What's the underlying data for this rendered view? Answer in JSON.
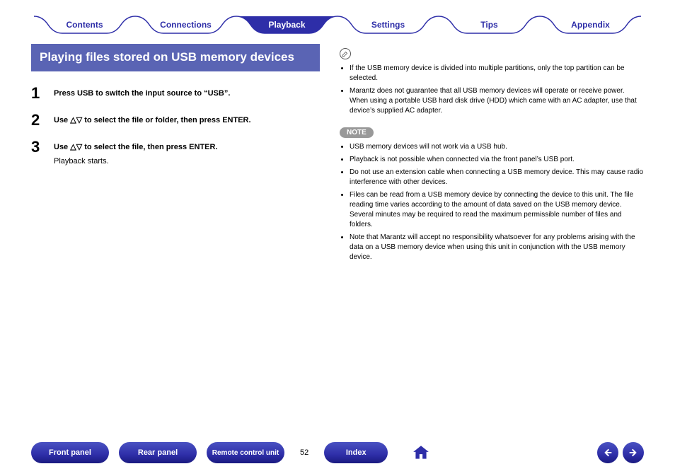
{
  "tabs": {
    "items": [
      {
        "label": "Contents",
        "active": false
      },
      {
        "label": "Connections",
        "active": false
      },
      {
        "label": "Playback",
        "active": true
      },
      {
        "label": "Settings",
        "active": false
      },
      {
        "label": "Tips",
        "active": false
      },
      {
        "label": "Appendix",
        "active": false
      }
    ]
  },
  "section_title": "Playing files stored on USB memory devices",
  "steps": [
    {
      "num": "1",
      "main": "Press USB to switch the input source to “USB”."
    },
    {
      "num": "2",
      "main": "Use △▽ to select the file or folder, then press ENTER."
    },
    {
      "num": "3",
      "main": "Use △▽ to select the file, then press ENTER.",
      "sub": "Playback starts."
    }
  ],
  "info_bullets": [
    "If the USB memory device is divided into multiple partitions, only the top partition can be selected.",
    "Marantz does not guarantee that all USB memory devices will operate or receive power. When using a portable USB hard disk drive (HDD) which came with an AC adapter, use that device’s supplied AC adapter."
  ],
  "note_label": "NOTE",
  "note_bullets": [
    "USB memory devices will not work via a USB hub.",
    "Playback is not possible when connected via the front panel’s USB port.",
    "Do not use an extension cable when connecting a USB memory device. This may cause radio interference with other devices.",
    "Files can be read from a USB memory device by connecting the device to this unit. The file reading time varies according to the amount of data saved on the USB memory device. Several minutes may be required to read the maximum permissible number of files and folders.",
    "Note that Marantz will accept no responsibility whatsoever for any problems arising with the data on a USB memory device when using this unit in conjunction with the USB memory device."
  ],
  "bottom": {
    "front_panel": "Front panel",
    "rear_panel": "Rear panel",
    "remote": "Remote control unit",
    "index": "Index",
    "page_number": "52"
  }
}
